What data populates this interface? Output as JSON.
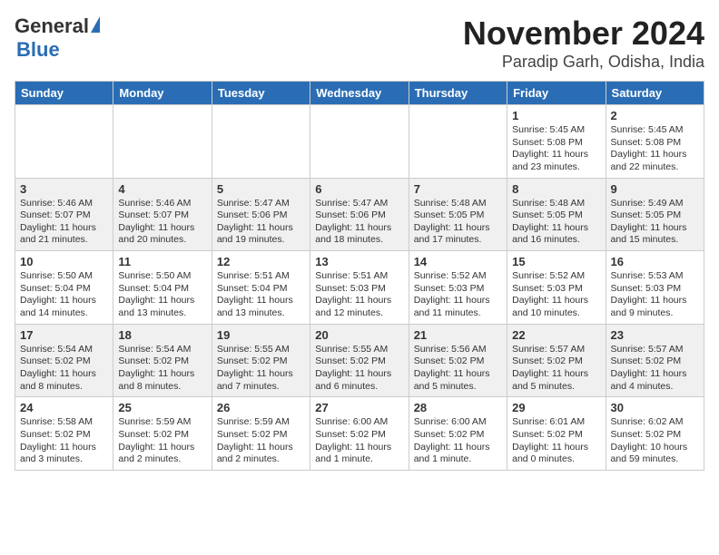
{
  "header": {
    "logo_general": "General",
    "logo_blue": "Blue",
    "title": "November 2024",
    "subtitle": "Paradip Garh, Odisha, India"
  },
  "weekdays": [
    "Sunday",
    "Monday",
    "Tuesday",
    "Wednesday",
    "Thursday",
    "Friday",
    "Saturday"
  ],
  "weeks": [
    [
      {
        "day": "",
        "info": ""
      },
      {
        "day": "",
        "info": ""
      },
      {
        "day": "",
        "info": ""
      },
      {
        "day": "",
        "info": ""
      },
      {
        "day": "",
        "info": ""
      },
      {
        "day": "1",
        "info": "Sunrise: 5:45 AM\nSunset: 5:08 PM\nDaylight: 11 hours\nand 23 minutes."
      },
      {
        "day": "2",
        "info": "Sunrise: 5:45 AM\nSunset: 5:08 PM\nDaylight: 11 hours\nand 22 minutes."
      }
    ],
    [
      {
        "day": "3",
        "info": "Sunrise: 5:46 AM\nSunset: 5:07 PM\nDaylight: 11 hours\nand 21 minutes."
      },
      {
        "day": "4",
        "info": "Sunrise: 5:46 AM\nSunset: 5:07 PM\nDaylight: 11 hours\nand 20 minutes."
      },
      {
        "day": "5",
        "info": "Sunrise: 5:47 AM\nSunset: 5:06 PM\nDaylight: 11 hours\nand 19 minutes."
      },
      {
        "day": "6",
        "info": "Sunrise: 5:47 AM\nSunset: 5:06 PM\nDaylight: 11 hours\nand 18 minutes."
      },
      {
        "day": "7",
        "info": "Sunrise: 5:48 AM\nSunset: 5:05 PM\nDaylight: 11 hours\nand 17 minutes."
      },
      {
        "day": "8",
        "info": "Sunrise: 5:48 AM\nSunset: 5:05 PM\nDaylight: 11 hours\nand 16 minutes."
      },
      {
        "day": "9",
        "info": "Sunrise: 5:49 AM\nSunset: 5:05 PM\nDaylight: 11 hours\nand 15 minutes."
      }
    ],
    [
      {
        "day": "10",
        "info": "Sunrise: 5:50 AM\nSunset: 5:04 PM\nDaylight: 11 hours\nand 14 minutes."
      },
      {
        "day": "11",
        "info": "Sunrise: 5:50 AM\nSunset: 5:04 PM\nDaylight: 11 hours\nand 13 minutes."
      },
      {
        "day": "12",
        "info": "Sunrise: 5:51 AM\nSunset: 5:04 PM\nDaylight: 11 hours\nand 13 minutes."
      },
      {
        "day": "13",
        "info": "Sunrise: 5:51 AM\nSunset: 5:03 PM\nDaylight: 11 hours\nand 12 minutes."
      },
      {
        "day": "14",
        "info": "Sunrise: 5:52 AM\nSunset: 5:03 PM\nDaylight: 11 hours\nand 11 minutes."
      },
      {
        "day": "15",
        "info": "Sunrise: 5:52 AM\nSunset: 5:03 PM\nDaylight: 11 hours\nand 10 minutes."
      },
      {
        "day": "16",
        "info": "Sunrise: 5:53 AM\nSunset: 5:03 PM\nDaylight: 11 hours\nand 9 minutes."
      }
    ],
    [
      {
        "day": "17",
        "info": "Sunrise: 5:54 AM\nSunset: 5:02 PM\nDaylight: 11 hours\nand 8 minutes."
      },
      {
        "day": "18",
        "info": "Sunrise: 5:54 AM\nSunset: 5:02 PM\nDaylight: 11 hours\nand 8 minutes."
      },
      {
        "day": "19",
        "info": "Sunrise: 5:55 AM\nSunset: 5:02 PM\nDaylight: 11 hours\nand 7 minutes."
      },
      {
        "day": "20",
        "info": "Sunrise: 5:55 AM\nSunset: 5:02 PM\nDaylight: 11 hours\nand 6 minutes."
      },
      {
        "day": "21",
        "info": "Sunrise: 5:56 AM\nSunset: 5:02 PM\nDaylight: 11 hours\nand 5 minutes."
      },
      {
        "day": "22",
        "info": "Sunrise: 5:57 AM\nSunset: 5:02 PM\nDaylight: 11 hours\nand 5 minutes."
      },
      {
        "day": "23",
        "info": "Sunrise: 5:57 AM\nSunset: 5:02 PM\nDaylight: 11 hours\nand 4 minutes."
      }
    ],
    [
      {
        "day": "24",
        "info": "Sunrise: 5:58 AM\nSunset: 5:02 PM\nDaylight: 11 hours\nand 3 minutes."
      },
      {
        "day": "25",
        "info": "Sunrise: 5:59 AM\nSunset: 5:02 PM\nDaylight: 11 hours\nand 2 minutes."
      },
      {
        "day": "26",
        "info": "Sunrise: 5:59 AM\nSunset: 5:02 PM\nDaylight: 11 hours\nand 2 minutes."
      },
      {
        "day": "27",
        "info": "Sunrise: 6:00 AM\nSunset: 5:02 PM\nDaylight: 11 hours\nand 1 minute."
      },
      {
        "day": "28",
        "info": "Sunrise: 6:00 AM\nSunset: 5:02 PM\nDaylight: 11 hours\nand 1 minute."
      },
      {
        "day": "29",
        "info": "Sunrise: 6:01 AM\nSunset: 5:02 PM\nDaylight: 11 hours\nand 0 minutes."
      },
      {
        "day": "30",
        "info": "Sunrise: 6:02 AM\nSunset: 5:02 PM\nDaylight: 10 hours\nand 59 minutes."
      }
    ]
  ]
}
